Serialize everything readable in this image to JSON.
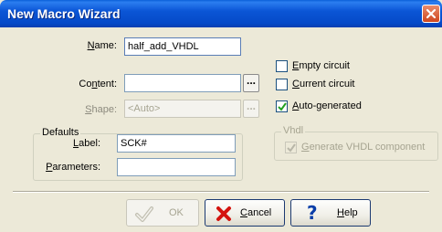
{
  "window": {
    "title": "New Macro Wizard"
  },
  "fields": {
    "name": {
      "label_u": "N",
      "label_rest": "ame:",
      "value": "half_add_VHDL"
    },
    "content": {
      "label_pre": "Co",
      "label_u": "n",
      "label_rest": "tent:",
      "value": ""
    },
    "shape": {
      "label_u": "S",
      "label_rest": "hape:",
      "value": "<Auto>"
    }
  },
  "dots_label": "...",
  "checkboxes": {
    "empty": {
      "label_u": "E",
      "label_rest": "mpty circuit",
      "checked": false
    },
    "current": {
      "label_u": "C",
      "label_rest": "urrent circuit",
      "checked": false
    },
    "auto": {
      "label_u": "A",
      "label_rest": "uto-generated",
      "checked": true
    }
  },
  "defaults": {
    "title": "Defaults",
    "label": {
      "label_u": "L",
      "label_rest": "abel:",
      "value": "SCK#"
    },
    "parameters": {
      "label_u": "P",
      "label_rest": "arameters:",
      "value": ""
    }
  },
  "vhdl": {
    "title": "Vhdl",
    "generate": {
      "label_u": "G",
      "label_rest": "enerate VHDL component",
      "checked": true
    }
  },
  "buttons": {
    "ok": "OK",
    "cancel": {
      "label_u": "C",
      "label_rest": "ancel"
    },
    "help": {
      "label_u": "H",
      "label_rest": "elp"
    }
  }
}
